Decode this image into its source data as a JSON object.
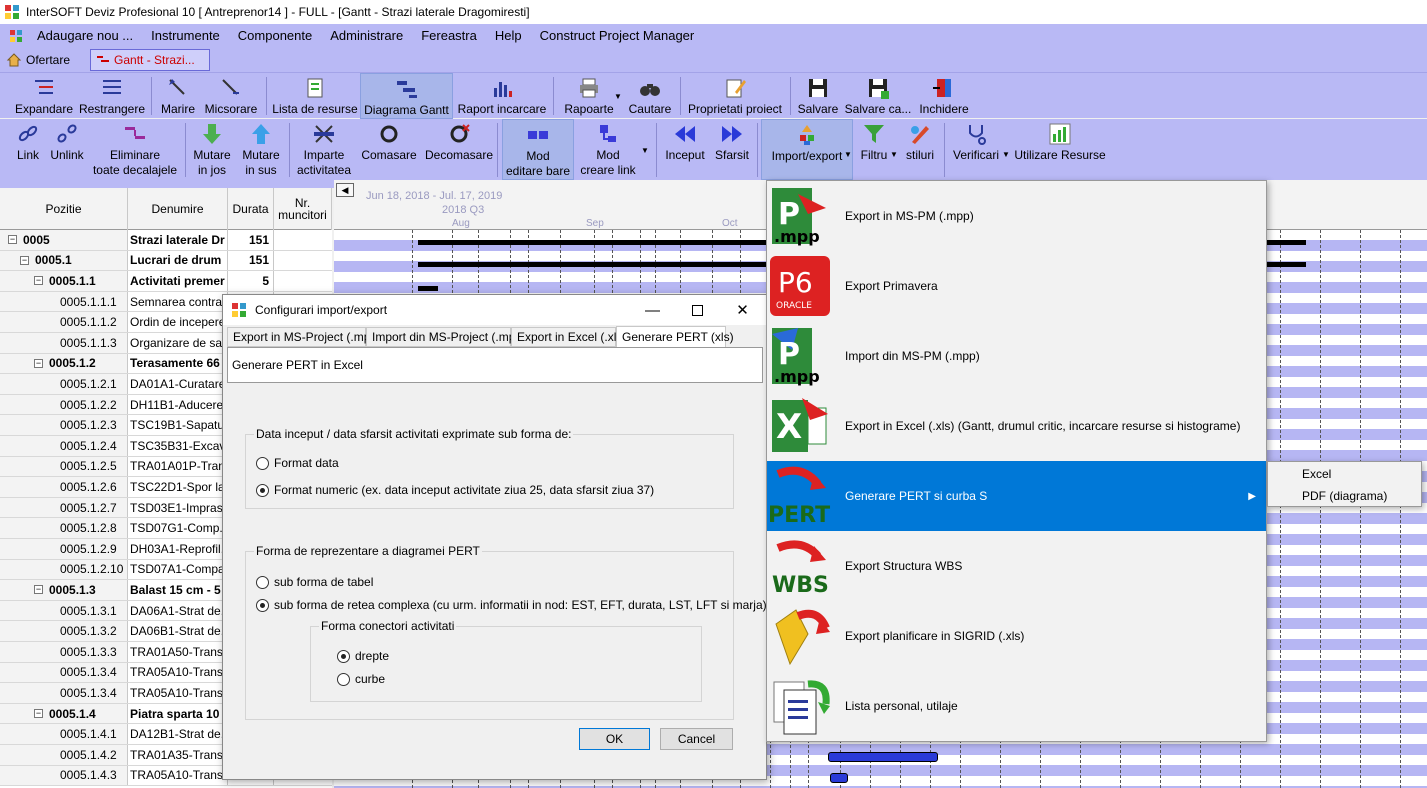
{
  "window": {
    "title": "InterSOFT Deviz Profesional 10 [ Antreprenor14 ] - FULL - [Gantt - Strazi laterale Dragomiresti]"
  },
  "menu": [
    "Adaugare nou ...",
    "Instrumente",
    "Componente",
    "Administrare",
    "Fereastra",
    "Help",
    "Construct Project Manager"
  ],
  "doc_tabs": [
    "Ofertare",
    "Gantt - Strazi..."
  ],
  "toolbar1": [
    {
      "label": "Expandare",
      "icon": "expand-icon"
    },
    {
      "label": "Restrangere",
      "icon": "collapse-icon"
    },
    {
      "label": "Marire",
      "icon": "zoom-in-icon"
    },
    {
      "label": "Micsorare",
      "icon": "zoom-out-icon"
    },
    {
      "label": "Lista de resurse",
      "icon": "resource-list-icon"
    },
    {
      "label": "Diagrama Gantt",
      "icon": "gantt-icon"
    },
    {
      "label": "Raport incarcare",
      "icon": "bar-chart-icon"
    },
    {
      "label": "Rapoarte",
      "icon": "printer-icon"
    },
    {
      "label": "Cautare",
      "icon": "binoculars-icon"
    },
    {
      "label": "Proprietati proiect",
      "icon": "pencil-doc-icon"
    },
    {
      "label": "Salvare",
      "icon": "save-icon"
    },
    {
      "label": "Salvare ca...",
      "icon": "save-as-icon"
    },
    {
      "label": "Inchidere",
      "icon": "close-door-icon"
    }
  ],
  "toolbar2": [
    {
      "label": "Link",
      "icon": "link-icon"
    },
    {
      "label": "Unlink",
      "icon": "unlink-icon"
    },
    {
      "label": "Eliminare\ntoate decalajele",
      "icon": "remove-lags-icon"
    },
    {
      "label": "Mutare\nin jos",
      "icon": "arrow-down-icon"
    },
    {
      "label": "Mutare\nin sus",
      "icon": "arrow-up-icon"
    },
    {
      "label": "Imparte\nactivitatea",
      "icon": "split-icon"
    },
    {
      "label": "Comasare",
      "icon": "merge-icon"
    },
    {
      "label": "Decomasare",
      "icon": "unmerge-icon"
    },
    {
      "label": "Mod\neditare bare",
      "icon": "bar-edit-icon"
    },
    {
      "label": "Mod\ncreare link",
      "icon": "link-mode-icon"
    },
    {
      "label": "Inceput",
      "icon": "rewind-icon"
    },
    {
      "label": "Sfarsit",
      "icon": "fast-forward-icon"
    },
    {
      "label": "Import/export",
      "icon": "import-export-icon"
    },
    {
      "label": "Filtru",
      "icon": "filter-icon"
    },
    {
      "label": "stiluri",
      "icon": "styles-icon"
    },
    {
      "label": "Verificari",
      "icon": "stethoscope-icon"
    },
    {
      "label": "Utilizare Resurse",
      "icon": "resource-usage-icon"
    }
  ],
  "grid": {
    "headers": [
      "Pozitie",
      "Denumire",
      "Durata",
      "Nr.\nmuncitori"
    ],
    "rows": [
      {
        "pos": "0005",
        "name": "Strazi laterale Dr",
        "dur": "151",
        "bold": true,
        "level": 0,
        "exp": "−"
      },
      {
        "pos": "0005.1",
        "name": "Lucrari de drum",
        "dur": "151",
        "bold": true,
        "level": 1,
        "exp": "−"
      },
      {
        "pos": "0005.1.1",
        "name": "Activitati premer",
        "dur": "5",
        "bold": true,
        "level": 2,
        "exp": "−"
      },
      {
        "pos": "0005.1.1.1",
        "name": "Semnarea contra...",
        "dur": "",
        "level": 3
      },
      {
        "pos": "0005.1.1.2",
        "name": "Ordin de incepere...",
        "dur": "",
        "level": 3
      },
      {
        "pos": "0005.1.1.3",
        "name": "Organizare de sa...",
        "dur": "",
        "level": 3
      },
      {
        "pos": "0005.1.2",
        "name": "Terasamente 66",
        "dur": "",
        "bold": true,
        "level": 2,
        "exp": "−"
      },
      {
        "pos": "0005.1.2.1",
        "name": "DA01A1-Curatare...",
        "dur": "",
        "level": 3
      },
      {
        "pos": "0005.1.2.2",
        "name": "DH11B1-Aducere...",
        "dur": "",
        "level": 3
      },
      {
        "pos": "0005.1.2.3",
        "name": "TSC19B1-Sapatu...",
        "dur": "",
        "level": 3
      },
      {
        "pos": "0005.1.2.4",
        "name": "TSC35B31-Excav...",
        "dur": "",
        "level": 3
      },
      {
        "pos": "0005.1.2.5",
        "name": "TRA01A01P-Tran...",
        "dur": "",
        "level": 3
      },
      {
        "pos": "0005.1.2.6",
        "name": "TSC22D1-Spor la...",
        "dur": "",
        "level": 3
      },
      {
        "pos": "0005.1.2.7",
        "name": "TSD03E1-Impras...",
        "dur": "",
        "level": 3
      },
      {
        "pos": "0005.1.2.8",
        "name": "TSD07G1-Comp...",
        "dur": "",
        "level": 3
      },
      {
        "pos": "0005.1.2.9",
        "name": "DH03A1-Reprofil...",
        "dur": "",
        "level": 3
      },
      {
        "pos": "0005.1.2.10",
        "name": "TSD07A1-Compa...",
        "dur": "",
        "level": 3
      },
      {
        "pos": "0005.1.3",
        "name": "Balast 15 cm - 5",
        "dur": "",
        "bold": true,
        "level": 2,
        "exp": "−"
      },
      {
        "pos": "0005.1.3.1",
        "name": "DA06A1-Strat de...",
        "dur": "",
        "level": 3
      },
      {
        "pos": "0005.1.3.2",
        "name": "DA06B1-Strat de...",
        "dur": "",
        "level": 3
      },
      {
        "pos": "0005.1.3.3",
        "name": "TRA01A50-Trans...",
        "dur": "",
        "level": 3
      },
      {
        "pos": "0005.1.3.4",
        "name": "TRA05A10-Trans...",
        "dur": "",
        "level": 3
      },
      {
        "pos": "0005.1.3.4",
        "name": "TRA05A10-Trans...",
        "dur": "",
        "level": 3
      },
      {
        "pos": "0005.1.4",
        "name": "Piatra sparta 10",
        "dur": "",
        "bold": true,
        "level": 2,
        "exp": "−"
      },
      {
        "pos": "0005.1.4.1",
        "name": "DA12B1-Strat de...",
        "dur": "",
        "level": 3
      },
      {
        "pos": "0005.1.4.2",
        "name": "TRA01A35-Trans...",
        "dur": "",
        "level": 3
      },
      {
        "pos": "0005.1.4.3",
        "name": "TRA05A10-Trans...",
        "dur": "",
        "level": 3
      }
    ]
  },
  "chart": {
    "date_range": "Jun 18, 2018 - Jul. 17, 2019",
    "year": "2018 Q3",
    "months": [
      "Aug",
      "Sep",
      "Oct"
    ]
  },
  "dialog": {
    "title": "Configurari import/export",
    "tabs": [
      "Export in MS-Project (.mpp)",
      "Import din MS-Project (.mpp)",
      "Export in Excel (.xls)",
      "Generare PERT (xls)"
    ],
    "panel_title": "Generare PERT in Excel",
    "group1": {
      "title": "Data inceput / data sfarsit activitati exprimate sub forma de:",
      "options": [
        "Format data",
        "Format numeric (ex. data inceput activitate ziua 25, data sfarsit ziua 37)"
      ],
      "selected": 1
    },
    "group2": {
      "title": "Forma de reprezentare a diagramei PERT",
      "options": [
        "sub forma de tabel",
        "sub forma de retea complexa (cu urm. informatii in nod: EST, EFT, durata, LST, LFT si marja)"
      ],
      "selected": 1
    },
    "group3": {
      "title": "Forma conectori activitati",
      "options": [
        "drepte",
        "curbe"
      ],
      "selected": 0
    },
    "ok": "OK",
    "cancel": "Cancel"
  },
  "dropdown": [
    {
      "label": "Export in MS-PM (.mpp)",
      "icon": "mpp-export-icon"
    },
    {
      "label": "Export Primavera",
      "icon": "primavera-p6-icon"
    },
    {
      "label": "Import din MS-PM (.mpp)",
      "icon": "mpp-import-icon"
    },
    {
      "label": "Export in Excel (.xls) (Gantt, drumul critic, incarcare resurse si histograme)",
      "icon": "excel-icon"
    },
    {
      "label": "Generare PERT si curba S",
      "icon": "pert-icon"
    },
    {
      "label": "Export Structura WBS",
      "icon": "wbs-icon"
    },
    {
      "label": "Export planificare in SIGRID (.xls)",
      "icon": "sigrid-icon"
    },
    {
      "label": "Lista personal, utilaje",
      "icon": "personnel-list-icon"
    }
  ],
  "dropdown_highlight": 4,
  "submenu": [
    "Excel",
    "PDF (diagrama)"
  ],
  "colors": {
    "accent": "#0078d7",
    "toolbar_bg": "#b9b9f5",
    "row_stripe": "#b6b6f3"
  }
}
